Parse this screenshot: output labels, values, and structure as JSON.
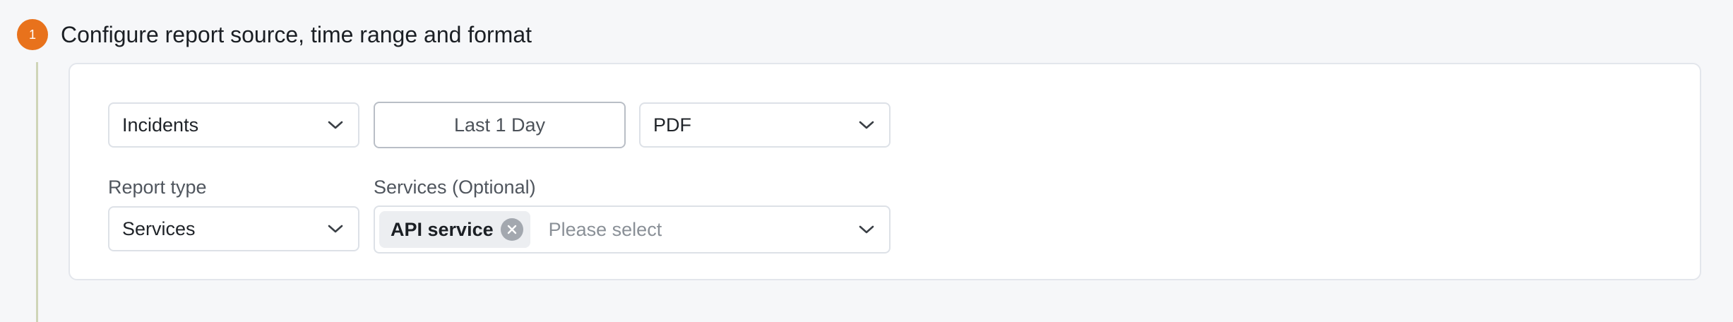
{
  "step": {
    "number": "1",
    "title": "Configure report source, time range and format",
    "badge_color": "#e8721c"
  },
  "controls": {
    "source": {
      "value": "Incidents",
      "icon": "chevron-down-icon"
    },
    "time_range": {
      "label": "Last 1 Day"
    },
    "format": {
      "value": "PDF",
      "icon": "chevron-down-icon"
    },
    "report_type": {
      "label": "Report type",
      "value": "Services",
      "icon": "chevron-down-icon"
    },
    "services": {
      "label": "Services (Optional)",
      "tags": [
        {
          "label": "API service",
          "icon": "close-circle-icon"
        }
      ],
      "placeholder": "Please select",
      "icon": "chevron-down-icon"
    }
  }
}
